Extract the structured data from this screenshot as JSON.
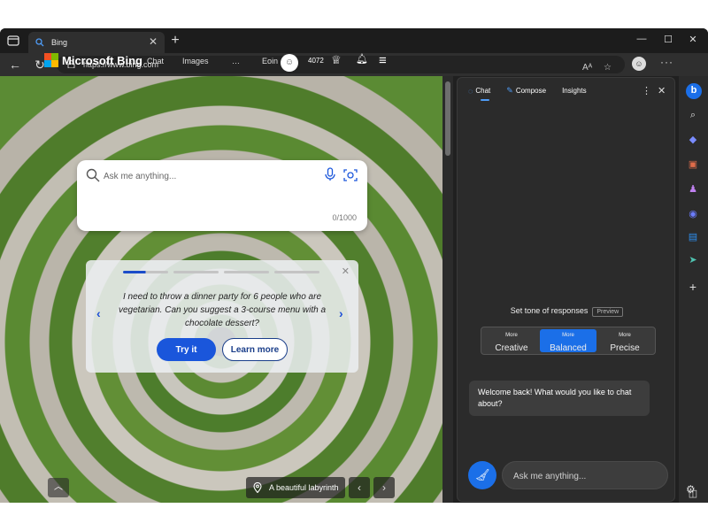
{
  "browser": {
    "tab_title": "Bing",
    "tab_close": "✕",
    "new_tab": "+",
    "url": "https://www.bing.com",
    "win_minimize": "—",
    "win_maximize": "☐",
    "win_close": "✕",
    "menu": "···",
    "read_aloud": "Aᴬ"
  },
  "bing": {
    "logo_text": "Microsoft Bing",
    "nav_chat": "Chat",
    "nav_images": "Images",
    "nav_more": "…",
    "region": "Eoin",
    "points": "4072",
    "search_placeholder": "Ask me anything...",
    "char_count": "0/1000",
    "carousel_prompt": "I need to throw a dinner party for 6 people who are vegetarian. Can you suggest a 3-course menu with a chocolate dessert?",
    "try_it": "Try it",
    "learn_more": "Learn more",
    "carousel_progress": 0.5,
    "image_caption": "A beautiful labyrinth"
  },
  "panel": {
    "tabs": [
      "Chat",
      "Compose",
      "Insights"
    ],
    "active_tab": "Chat",
    "tone_title": "Set tone of responses",
    "tone_badge": "Preview",
    "tones": [
      {
        "more": "More",
        "name": "Creative"
      },
      {
        "more": "More",
        "name": "Balanced"
      },
      {
        "more": "More",
        "name": "Precise"
      }
    ],
    "selected_tone": "Balanced",
    "welcome": "Welcome back! What would you like to chat about?",
    "input_placeholder": "Ask me anything..."
  },
  "colors": {
    "accent": "#1b6fe8",
    "bing_blue": "#1a56db",
    "dark_bg": "#2b2b2b"
  },
  "sidebar_icons": [
    "bing-chat-icon",
    "search-icon",
    "tag-icon",
    "briefcase-icon",
    "games-icon",
    "microsoft365-icon",
    "outlook-icon",
    "send-icon",
    "add-icon",
    "sidebar-toggle-icon",
    "settings-icon"
  ]
}
